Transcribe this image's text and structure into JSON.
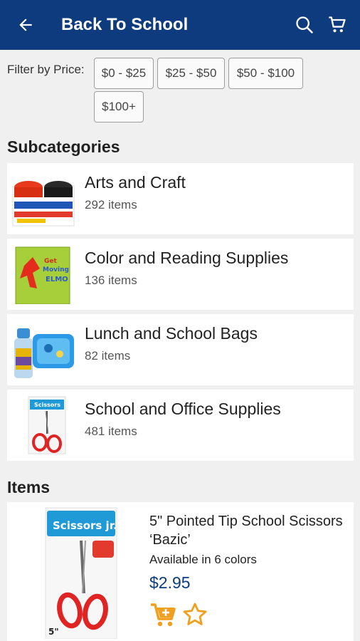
{
  "header": {
    "title": "Back To School",
    "back_icon": "arrow-back-icon",
    "search_icon": "search-icon",
    "cart_icon": "shopping-cart-icon",
    "bg_color": "#0d3b7e"
  },
  "filter": {
    "label": "Filter by Price:",
    "options": [
      "$0 - $25",
      "$25 - $50",
      "$50 - $100",
      "$100+"
    ]
  },
  "subcategories": {
    "title": "Subcategories",
    "items": [
      {
        "name": "Arts and Craft",
        "count": "292 items"
      },
      {
        "name": "Color and Reading Supplies",
        "count": "136 items"
      },
      {
        "name": "Lunch and School Bags",
        "count": "82 items"
      },
      {
        "name": "School and Office Supplies",
        "count": "481 items"
      }
    ]
  },
  "items": {
    "title": "Items",
    "list": [
      {
        "name": "5\" Pointed Tip School Scissors ‘Bazic’",
        "colors": "Available in 6 colors",
        "price": "$2.95",
        "add_icon": "add-to-cart-icon",
        "fav_icon": "star-outline-icon",
        "price_color": "#0d3b7e",
        "action_color": "#f0a020"
      }
    ]
  }
}
